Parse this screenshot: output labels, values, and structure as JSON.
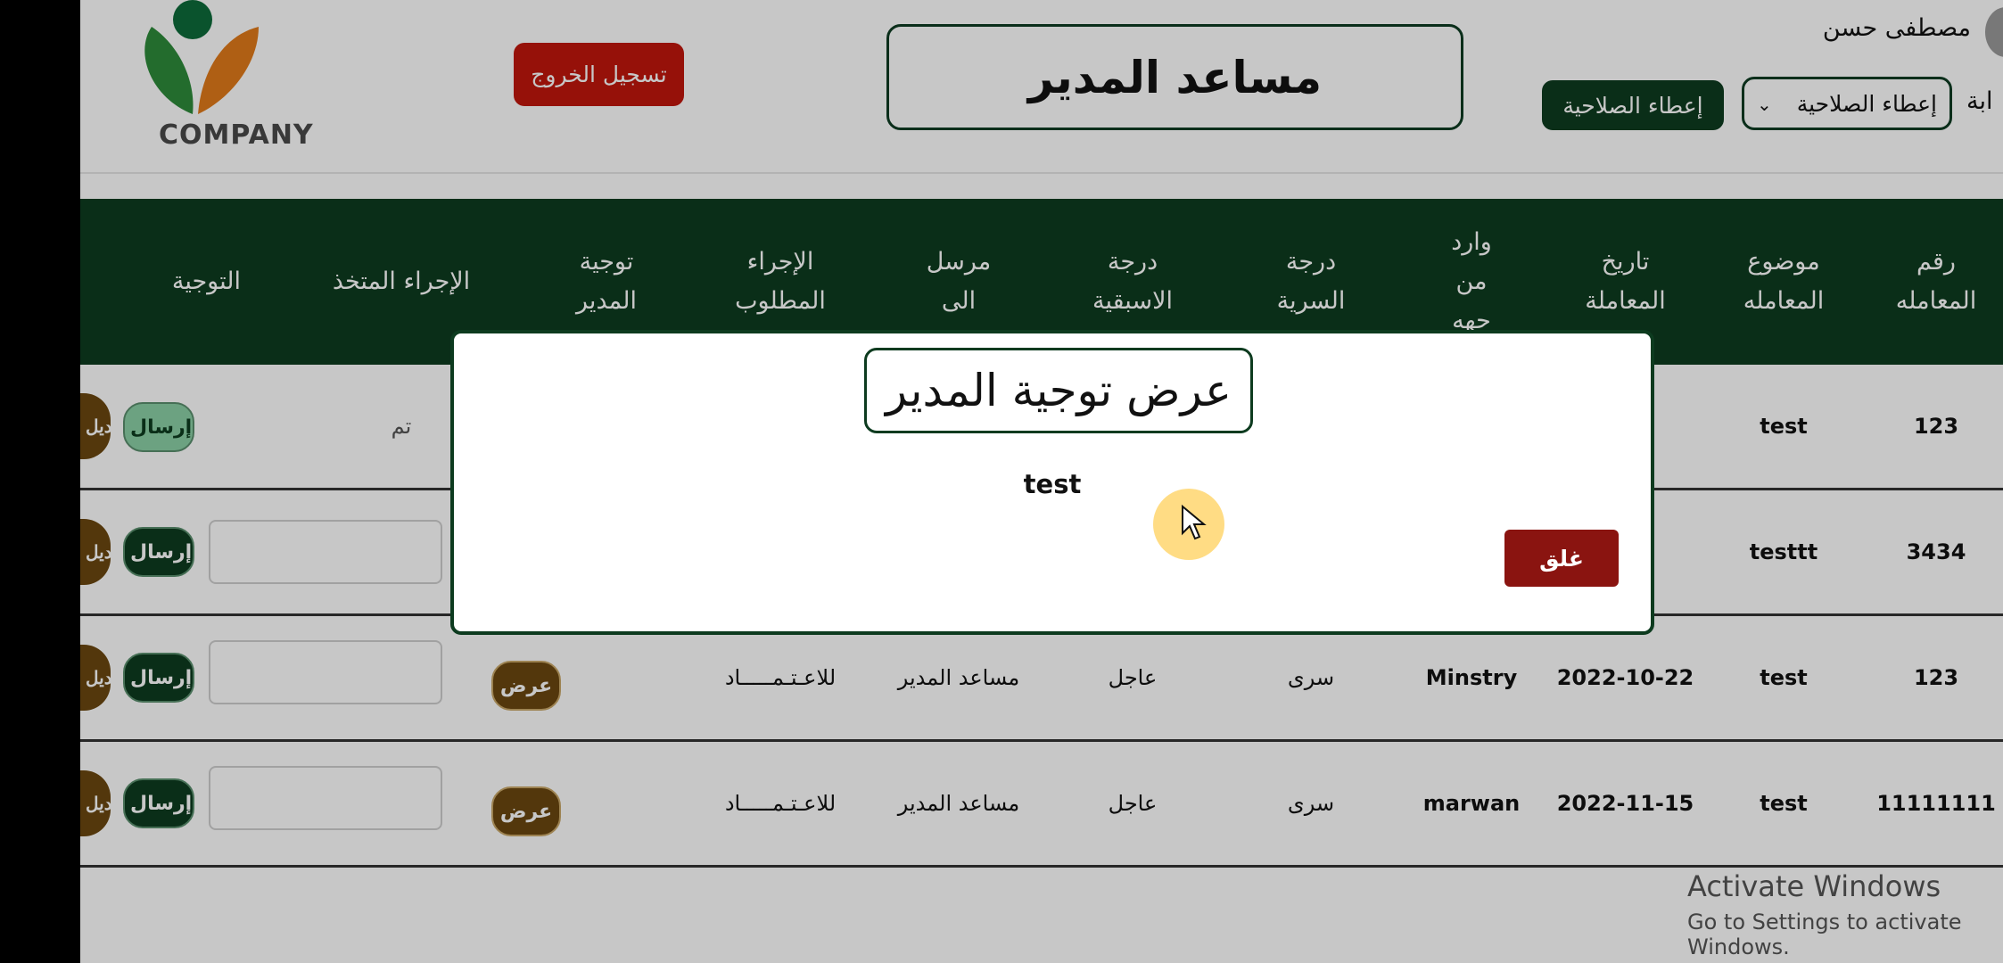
{
  "header": {
    "logo_text": "COMPANY",
    "logout_label": "تسجيل الخروج",
    "page_title": "مساعد المدير",
    "username": "مصطفى حسن",
    "grant_button_label": "إعطاء الصلاحية",
    "grant_select_value": "إعطاء الصلاحية",
    "cut_label": "ابة"
  },
  "table": {
    "columns": [
      "رقم\nالمعامله",
      "موضوع\nالمعامله",
      "تاريخ\nالمعاملة",
      "وارد\nمن\nجهه",
      "درجة\nالسرية",
      "درجة\nالاسبقية",
      "مرسل\nالى",
      "الإجراء\nالمطلوب",
      "توجية\nالمدير",
      "الإجراء المتخذ",
      "التوجية"
    ],
    "rows": [
      {
        "number": "123",
        "subject": "test",
        "action_taken": "تم",
        "send_label": "إرسال",
        "edit_label": "تعديل"
      },
      {
        "number": "3434",
        "subject": "testtt",
        "send_label": "إرسال",
        "edit_label": "تعديل"
      },
      {
        "number": "123",
        "subject": "test",
        "date": "2022-10-22",
        "from": "Minstry",
        "secrecy": "سرى",
        "priority": "عاجل",
        "sent_to": "مساعد المدير",
        "required_action": "للاعـتـمـــــاد",
        "view_label": "عرض",
        "send_label": "إرسال",
        "edit_label": "تعديل"
      },
      {
        "number": "11111111",
        "subject": "test",
        "date": "2022-11-15",
        "from": "marwan",
        "secrecy": "سرى",
        "priority": "عاجل",
        "sent_to": "مساعد المدير",
        "required_action": "للاعـتـمـــــاد",
        "view_label": "عرض",
        "send_label": "إرسال",
        "edit_label": "تعديل"
      }
    ]
  },
  "modal": {
    "title": "عرض توجية المدير",
    "body": "test",
    "close_label": "غلق"
  },
  "watermark": {
    "line1": "Activate Windows",
    "line2": "Go to Settings to activate Windows."
  },
  "colors": {
    "primary_green": "#0d3b1f",
    "logout_red": "#c0160c",
    "brown": "#6b4710",
    "close_red": "#8a1410"
  }
}
